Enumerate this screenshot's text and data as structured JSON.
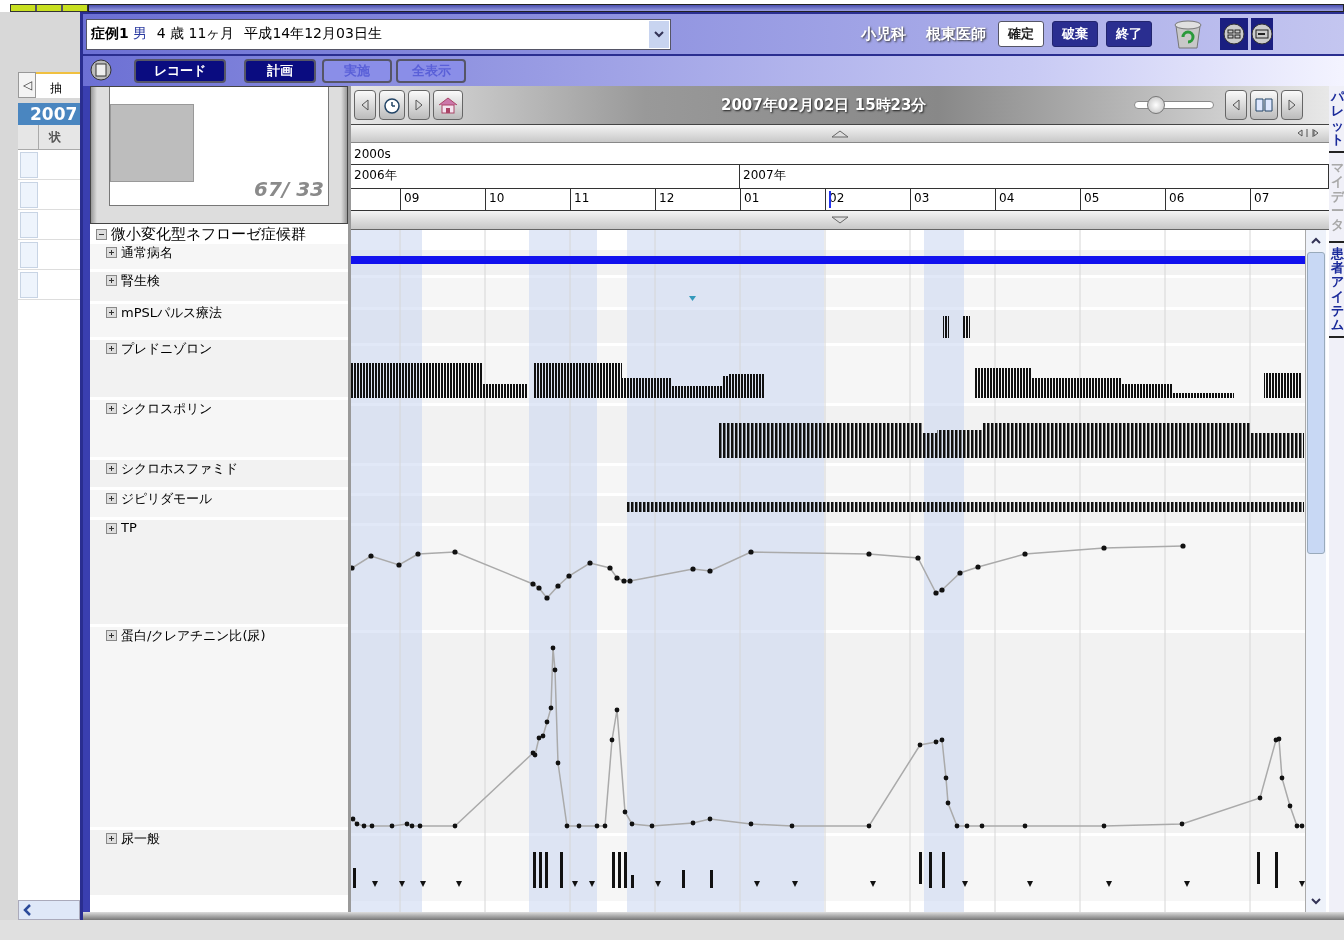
{
  "side_panel": {
    "tab_button": "◁",
    "tab": "抽",
    "year": "2007",
    "column": "状",
    "rows": [
      {
        "checked": false
      },
      {
        "checked": false
      },
      {
        "checked": false
      },
      {
        "checked": false
      },
      {
        "checked": false
      }
    ]
  },
  "patient": {
    "case": "症例1",
    "sex": "男",
    "age": "4 歳 11ヶ月",
    "birth": "平成14年12月03日生"
  },
  "department": "小児科",
  "doctor": "根東医師",
  "buttons": [
    {
      "label": "確定",
      "kind": "light"
    },
    {
      "label": "破棄",
      "kind": "dark"
    },
    {
      "label": "終了",
      "kind": "dark"
    }
  ],
  "view_tabs": [
    {
      "label": "レコード",
      "on": true
    },
    {
      "label": "計画",
      "on": true
    },
    {
      "label": "実施",
      "on": false
    },
    {
      "label": "全表示",
      "on": false
    }
  ],
  "thumbnail": {
    "counter": "67/ 33"
  },
  "timeline": {
    "datetime": "2007年02月02日 15時23分",
    "zoom": {
      "level": 0.2
    },
    "decade": "2000s",
    "years": [
      "2006年",
      "2007年"
    ],
    "months": [
      "09",
      "10",
      "11",
      "12",
      "01",
      "02",
      "03",
      "04",
      "05",
      "06",
      "07"
    ]
  },
  "tree": {
    "label": "微小変化型ネフローゼ症候群",
    "expanded": true,
    "children": [
      {
        "label": "通常病名",
        "expanded": false
      },
      {
        "label": "腎生検",
        "expanded": false
      },
      {
        "label": "mPSLパルス療法",
        "expanded": false
      },
      {
        "label": "プレドニゾロン",
        "expanded": false
      },
      {
        "label": "シクロスポリン",
        "expanded": false
      },
      {
        "label": "シクロホスファミド",
        "expanded": false
      },
      {
        "label": "ジピリダモール",
        "expanded": false
      },
      {
        "label": "TP",
        "expanded": false
      },
      {
        "label": "蛋白/クレアチニン比(尿)",
        "expanded": false
      },
      {
        "label": "尿一般",
        "expanded": false
      }
    ]
  },
  "right_tabs": [
    {
      "label": "パレット",
      "disabled": false
    },
    {
      "label": "マイデータ",
      "disabled": true
    },
    {
      "label": "患者アイテム",
      "disabled": false
    }
  ]
}
